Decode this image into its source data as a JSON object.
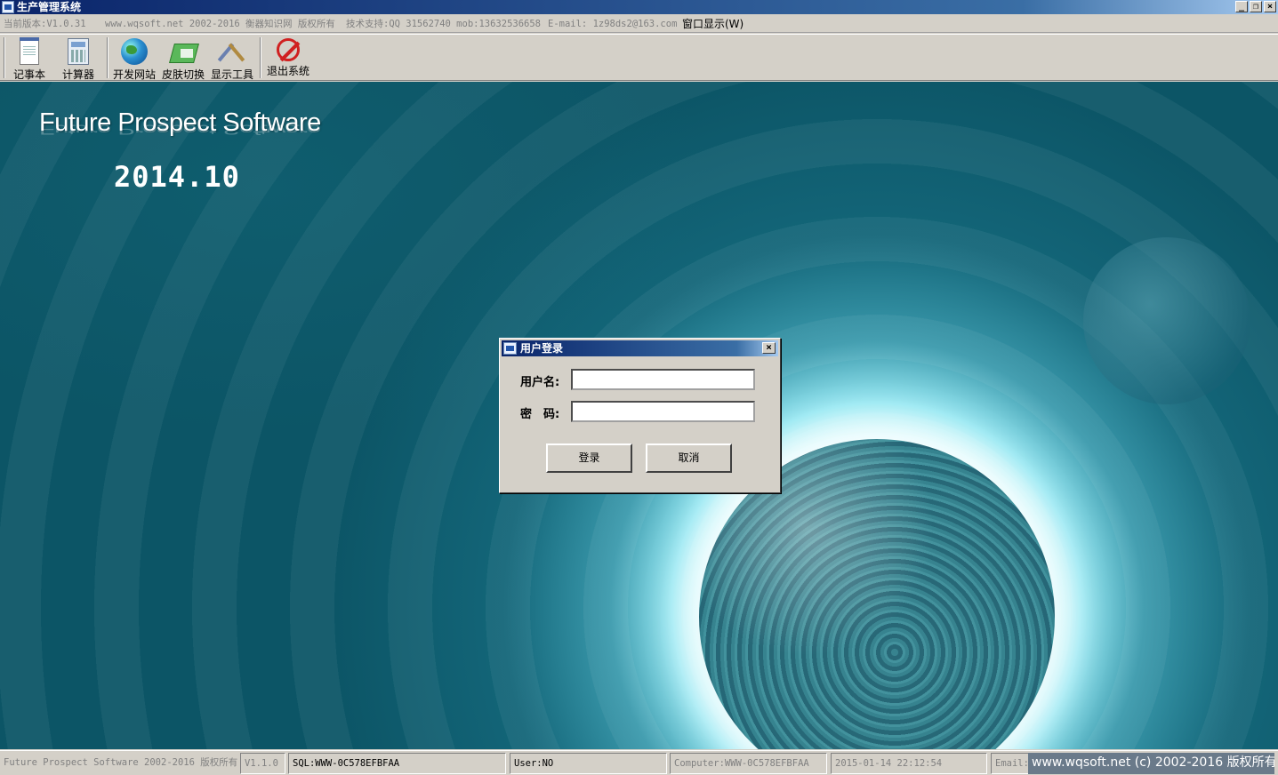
{
  "window": {
    "title": "生产管理系统",
    "controls": [
      "_",
      "❐",
      "×"
    ]
  },
  "infobar": {
    "version": "当前版本:V1.0.31",
    "site": "www.wqsoft.net 2002-2016 衡器知识网 版权所有",
    "support": "技术支持:QQ 31562740 mob:13632536658",
    "email": "E-mail: 1z98ds2@163.com",
    "menu_label": "窗口显示(W)"
  },
  "toolbar": {
    "items": [
      {
        "label": "记事本",
        "icon": "notepad-icon"
      },
      {
        "label": "计算器",
        "icon": "calculator-icon"
      },
      {
        "label": "开发网站",
        "icon": "globe-icon"
      },
      {
        "label": "皮肤切换",
        "icon": "skin-icon"
      },
      {
        "label": "显示工具",
        "icon": "tools-icon"
      },
      {
        "label": "退出系统",
        "icon": "exit-icon"
      }
    ]
  },
  "splash": {
    "brand": "Future Prospect Software",
    "version": "2014.10"
  },
  "login": {
    "title": "用户登录",
    "close": "×",
    "username_label": "用户名:",
    "password_label": "密　码:",
    "username_value": "",
    "password_value": "",
    "login_button": "登录",
    "cancel_button": "取消"
  },
  "statusbar": {
    "copyright": "Future Prospect Software 2002-2016 版权所有",
    "version": "V1.1.0",
    "sql": "SQL:WWW-0C578EFBFAA",
    "user": "User:NO",
    "computer": "Computer:WWW-0C578EFBFAA",
    "datetime": "2015-01-14 22:12:54",
    "email_label": "Email:",
    "site_notice": "www.wqsoft.net (c) 2002-2016 版权所有"
  }
}
